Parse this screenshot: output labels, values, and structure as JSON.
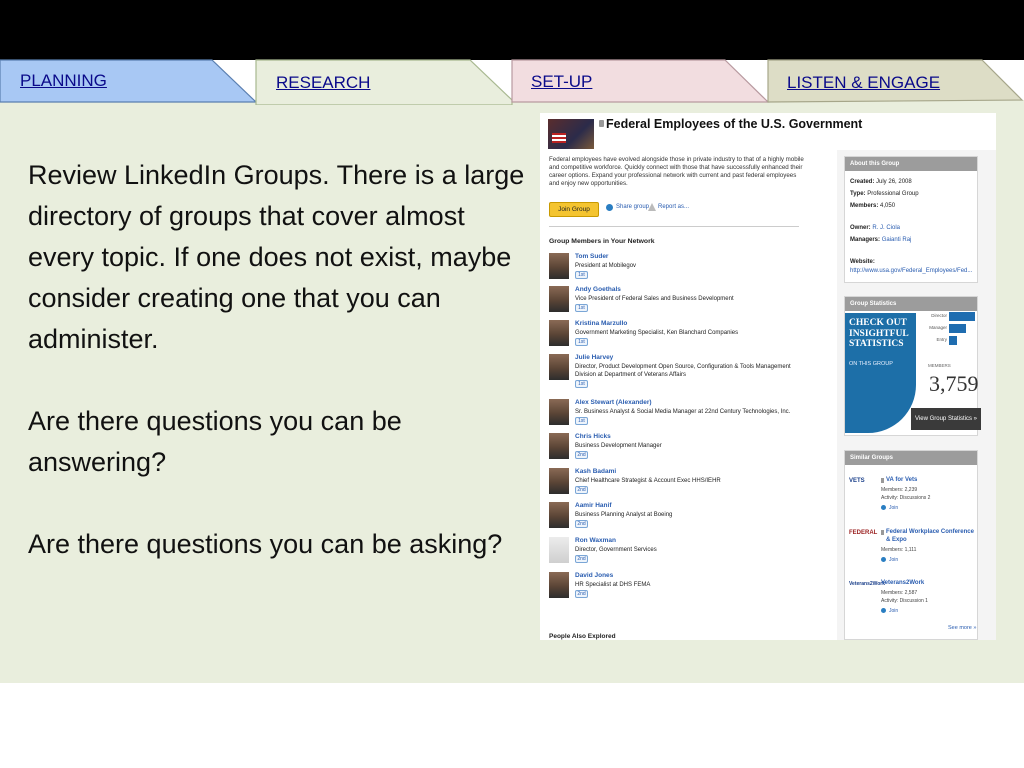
{
  "tabs": [
    {
      "label": "PLANNING",
      "color": "#a8c8f4"
    },
    {
      "label": "RESEARCH",
      "color": "#e9eedd"
    },
    {
      "label": "SET-UP",
      "color": "#f2dde0"
    },
    {
      "label": "LISTEN & ENGAGE",
      "color": "#ddddc6"
    }
  ],
  "body": {
    "p1": "Review LinkedIn Groups. There is a large directory of groups that cover almost every topic. If one does not exist, maybe consider creating one that you can administer.",
    "p2": "Are there questions you can be answering?",
    "p3": "Are there questions you can be asking?"
  },
  "screenshot": {
    "group_title": "Federal Employees of the U.S. Government",
    "description": "Federal employees have evolved alongside those in private industry to that of a highly mobile and competitive workforce. Quickly connect with those that have successfully enhanced their career options. Expand your professional network with current and past federal employees and enjoy new opportunities.",
    "join_button": "Join Group",
    "share_group": "Share group",
    "report_as": "Report as...",
    "members_heading": "Group Members in Your Network",
    "members": [
      {
        "name": "Tom Suder",
        "title": "President at Mobilegov",
        "degree": "1st"
      },
      {
        "name": "Andy Goethals",
        "title": "Vice President of Federal Sales and Business Development",
        "degree": "1st"
      },
      {
        "name": "Kristina Marzullo",
        "title": "Government Marketing Specialist, Ken Blanchard Companies",
        "degree": "1st"
      },
      {
        "name": "Julie Harvey",
        "title": "Director, Product Development Open Source, Configuration & Tools Management Division at Department of Veterans Affairs",
        "degree": "1st"
      },
      {
        "name": "Alex Stewart (Alexander)",
        "title": "Sr. Business Analyst & Social Media Manager at 22nd Century Technologies, Inc.",
        "degree": "1st"
      },
      {
        "name": "Chris Hicks",
        "title": "Business Development Manager",
        "degree": "2nd"
      },
      {
        "name": "Kash Badami",
        "title": "Chief Healthcare Strategist & Account Exec HHS/IEHR",
        "degree": "2nd"
      },
      {
        "name": "Aamir Hanif",
        "title": "Business Planning Analyst at Boeing",
        "degree": "2nd"
      },
      {
        "name": "Ron Waxman",
        "title": "Director, Government Services",
        "degree": "2nd"
      },
      {
        "name": "David Jones",
        "title": "HR Specialist at DHS FEMA",
        "degree": "2nd"
      }
    ],
    "people_also": "People Also Explored",
    "about": {
      "heading": "About this Group",
      "created_label": "Created:",
      "created": "July 26, 2008",
      "type_label": "Type:",
      "type": "Professional Group",
      "members_label": "Members:",
      "members": "4,050",
      "owner_label": "Owner:",
      "owner": "R. J. Ciola",
      "managers_label": "Managers:",
      "managers": "Gaianti Raj",
      "website_label": "Website:",
      "website": "http://www.usa.gov/Federal_Employees/Fed..."
    },
    "stats": {
      "heading": "Group Statistics",
      "promo": "CHECK OUT INSIGHTFUL STATISTICS",
      "promo_sub": "ON THIS GROUP",
      "levels": [
        {
          "label": "Director",
          "share": 0.85
        },
        {
          "label": "Manager",
          "share": 0.55
        },
        {
          "label": "Entry",
          "share": 0.25
        }
      ],
      "members_label": "MEMBERS",
      "members_count": "3,759",
      "button": "View Group Statistics »"
    },
    "similar": {
      "heading": "Similar Groups",
      "groups": [
        {
          "logo": "VETS",
          "name": "VA for Vets",
          "members": "Members: 2,239",
          "activity": "Activity: Discussions 2",
          "join": "Join"
        },
        {
          "logo": "FEDERAL",
          "name": "Federal Workplace Conference & Expo",
          "members": "Members: 1,111",
          "activity": "",
          "join": "Join"
        },
        {
          "logo": "Veterans2Work",
          "name": "Veterans2Work",
          "members": "Members: 2,587",
          "activity": "Activity: Discussion 1",
          "join": "Join"
        }
      ],
      "see_more": "See more »"
    }
  }
}
